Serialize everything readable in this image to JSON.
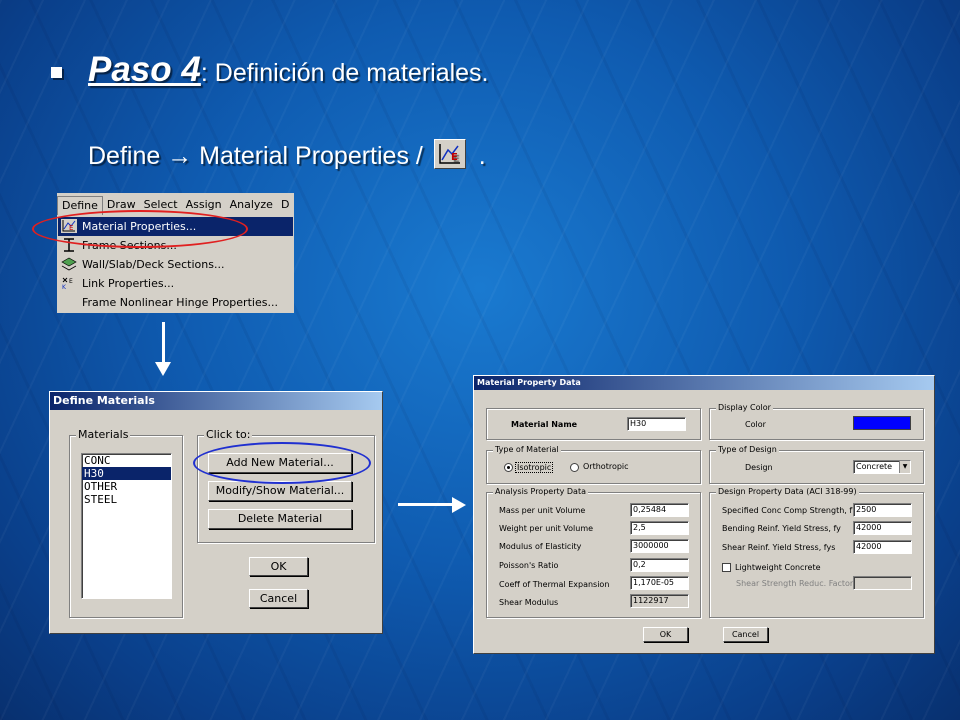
{
  "heading": {
    "step": "Paso 4",
    "colon": ":",
    "title": " Definición de materiales."
  },
  "instruction": {
    "path": "Define → Material Properties /",
    "suffix": "."
  },
  "define_menu": {
    "menubar": [
      "Define",
      "Draw",
      "Select",
      "Assign",
      "Analyze",
      "D"
    ],
    "items": [
      {
        "label": "Material Properties...",
        "icon": "material-icon",
        "selected": true
      },
      {
        "label": "Frame Sections...",
        "icon": "frame-section-icon"
      },
      {
        "label": "Wall/Slab/Deck Sections...",
        "icon": "layers-icon"
      },
      {
        "label": "Link Properties...",
        "icon": "link-icon"
      },
      {
        "label": "Frame Nonlinear Hinge Properties...",
        "icon": ""
      }
    ]
  },
  "define_materials": {
    "title": "Define Materials",
    "materials_label": "Materials",
    "materials": [
      "CONC",
      "H30",
      "OTHER",
      "STEEL"
    ],
    "selected_index": 1,
    "click_to_label": "Click to:",
    "add_button": "Add New Material...",
    "modify_button": "Modify/Show Material...",
    "delete_button": "Delete Material",
    "ok_button": "OK",
    "cancel_button": "Cancel"
  },
  "material_property": {
    "title": "Material Property Data",
    "name_label": "Material Name",
    "name_value": "H30",
    "display_color_label": "Display Color",
    "color_label": "Color",
    "color_value": "#0000ff",
    "type_of_material_label": "Type of Material",
    "isotropic_label": "Isotropic",
    "orthotropic_label": "Orthotropic",
    "type_of_design_label": "Type of Design",
    "design_label": "Design",
    "design_value": "Concrete",
    "analysis_label": "Analysis Property Data",
    "analysis": [
      {
        "label": "Mass per unit Volume",
        "value": "0,25484"
      },
      {
        "label": "Weight per unit Volume",
        "value": "2,5"
      },
      {
        "label": "Modulus of Elasticity",
        "value": "3000000"
      },
      {
        "label": "Poisson's Ratio",
        "value": "0,2"
      },
      {
        "label": "Coeff of Thermal Expansion",
        "value": "1,170E-05"
      },
      {
        "label": "Shear Modulus",
        "value": "1122917"
      }
    ],
    "design_data_label": "Design Property Data (ACI 318-99)",
    "design_data": [
      {
        "label": "Specified Conc Comp Strength, f'c",
        "value": "2500"
      },
      {
        "label": "Bending Reinf. Yield Stress, fy",
        "value": "42000"
      },
      {
        "label": "Shear Reinf. Yield Stress, fys",
        "value": "42000"
      }
    ],
    "lightweight_label": "Lightweight Concrete",
    "shear_reduc_label": "Shear Strength Reduc. Factor",
    "shear_reduc_value": "",
    "ok_button": "OK",
    "cancel_button": "Cancel"
  }
}
